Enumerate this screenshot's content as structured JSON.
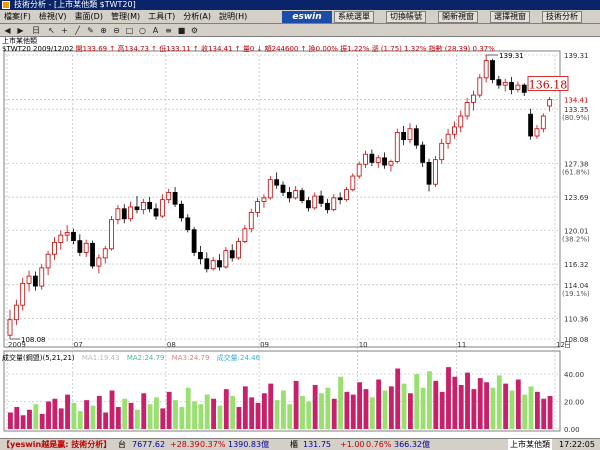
{
  "window": {
    "title": "技術分析 - [上市某他類 $TWT20]"
  },
  "menu": [
    {
      "label": "檔案(F)"
    },
    {
      "label": "檢視(V)"
    },
    {
      "label": "畫面(D)"
    },
    {
      "label": "管理(M)"
    },
    {
      "label": "工具(T)"
    },
    {
      "label": "分析(A)"
    },
    {
      "label": "說明(H)"
    }
  ],
  "brand": "eswin",
  "top_buttons": [
    {
      "label": "系統選單"
    },
    {
      "label": "切換帳號"
    },
    {
      "label": "開新視窗"
    },
    {
      "label": "選擇視窗"
    },
    {
      "label": "技術分析"
    }
  ],
  "toolbar": {
    "freq_label": "日",
    "items": [
      "arrow-icon",
      "crosshair-icon",
      "line-tool-icon",
      "pen-icon",
      "zoom-in-icon",
      "zoom-out-icon",
      "rect-icon",
      "ellipse-icon",
      "text-icon",
      "fib-icon",
      "color-icon",
      "gear-icon"
    ]
  },
  "header": {
    "name": "上市某他類",
    "info_prefix": "$TWT20 2009/12/02",
    "info": "開133.69 ↑ 高134.73 ↑ 低133.11 ↑ 收134.41 ↑ 量0 ↓ 額244600 ↑ 換0.00% 振1.22% 漲 (1.75) 1.32% 指數 (28.39) 0.37%"
  },
  "chart_data": [
    {
      "type": "candlestick",
      "y_ticks": [
        "139.31",
        "134.41",
        "133.35",
        "127.38",
        "123.69",
        "120.01",
        "116.32",
        "114.04",
        "110.36",
        "108.08"
      ],
      "y_ticks_pct": [
        "(80.9%)",
        "(61.8%)",
        "(38.2%)",
        "(19.1%)"
      ],
      "ylim": [
        108.08,
        139.31
      ],
      "x_ticks": [
        "2009",
        "07",
        "08",
        "09",
        "10",
        "11",
        "12"
      ],
      "annotations": {
        "high_label": "139.31",
        "low_label": "108.08",
        "current_price_box": "136.18",
        "current_price": "134.41"
      },
      "candles": [
        [
          108.5,
          111.3,
          108.1,
          110.2
        ],
        [
          110.2,
          112.4,
          109.6,
          111.8
        ],
        [
          111.8,
          114.8,
          111.2,
          114.2
        ],
        [
          114.2,
          115.6,
          113.3,
          115.0
        ],
        [
          115.0,
          115.5,
          113.4,
          113.9
        ],
        [
          113.9,
          116.3,
          113.5,
          115.9
        ],
        [
          115.9,
          117.8,
          115.1,
          117.4
        ],
        [
          117.4,
          119.3,
          116.8,
          118.7
        ],
        [
          118.7,
          120.0,
          117.9,
          119.5
        ],
        [
          119.5,
          120.6,
          118.8,
          119.8
        ],
        [
          119.8,
          120.2,
          118.5,
          118.9
        ],
        [
          118.9,
          119.6,
          117.2,
          117.6
        ],
        [
          117.6,
          119.0,
          117.1,
          118.6
        ],
        [
          118.6,
          118.9,
          115.8,
          116.1
        ],
        [
          116.1,
          117.4,
          115.3,
          117.0
        ],
        [
          117.0,
          118.3,
          116.4,
          118.0
        ],
        [
          118.0,
          121.6,
          117.8,
          121.2
        ],
        [
          121.2,
          122.8,
          120.7,
          122.4
        ],
        [
          122.4,
          122.9,
          120.8,
          121.3
        ],
        [
          121.3,
          123.2,
          121.0,
          122.6
        ],
        [
          122.6,
          123.8,
          121.9,
          122.3
        ],
        [
          122.3,
          123.5,
          121.8,
          123.1
        ],
        [
          123.1,
          123.7,
          122.0,
          122.4
        ],
        [
          122.4,
          123.0,
          121.2,
          121.6
        ],
        [
          121.6,
          124.0,
          121.4,
          123.4
        ],
        [
          123.4,
          124.6,
          123.0,
          124.2
        ],
        [
          124.2,
          124.8,
          122.6,
          122.9
        ],
        [
          122.9,
          123.3,
          121.0,
          121.4
        ],
        [
          121.4,
          121.8,
          119.8,
          120.1
        ],
        [
          120.1,
          120.4,
          117.2,
          117.6
        ],
        [
          117.6,
          118.3,
          116.3,
          116.9
        ],
        [
          116.9,
          117.6,
          115.4,
          115.8
        ],
        [
          115.8,
          117.1,
          115.6,
          116.7
        ],
        [
          116.7,
          117.4,
          115.6,
          116.0
        ],
        [
          116.0,
          118.2,
          115.8,
          117.8
        ],
        [
          117.8,
          118.5,
          116.6,
          117.0
        ],
        [
          117.0,
          119.2,
          116.8,
          118.8
        ],
        [
          118.8,
          120.6,
          118.6,
          120.2
        ],
        [
          120.2,
          122.4,
          119.8,
          122.0
        ],
        [
          122.0,
          123.6,
          121.5,
          123.2
        ],
        [
          123.2,
          124.0,
          122.5,
          123.6
        ],
        [
          123.6,
          126.0,
          123.4,
          125.6
        ],
        [
          125.6,
          126.4,
          124.6,
          125.0
        ],
        [
          125.0,
          125.4,
          123.8,
          124.2
        ],
        [
          124.2,
          124.8,
          123.1,
          123.6
        ],
        [
          123.6,
          124.9,
          123.4,
          124.4
        ],
        [
          124.4,
          124.7,
          123.0,
          123.3
        ],
        [
          123.3,
          123.7,
          122.1,
          122.5
        ],
        [
          122.5,
          124.2,
          122.3,
          123.8
        ],
        [
          123.8,
          124.4,
          122.6,
          123.0
        ],
        [
          123.0,
          123.5,
          121.9,
          122.3
        ],
        [
          122.3,
          124.0,
          122.1,
          123.6
        ],
        [
          123.6,
          124.2,
          122.9,
          123.4
        ],
        [
          123.4,
          124.8,
          123.2,
          124.5
        ],
        [
          124.5,
          126.3,
          124.3,
          126.0
        ],
        [
          126.0,
          127.6,
          125.7,
          127.3
        ],
        [
          127.3,
          128.8,
          126.9,
          128.4
        ],
        [
          128.4,
          128.9,
          127.1,
          127.5
        ],
        [
          127.5,
          128.3,
          126.9,
          128.0
        ],
        [
          128.0,
          128.6,
          126.8,
          127.2
        ],
        [
          127.2,
          127.8,
          126.5,
          127.6
        ],
        [
          127.6,
          131.2,
          127.4,
          130.8
        ],
        [
          130.8,
          131.5,
          129.4,
          130.0
        ],
        [
          130.0,
          131.8,
          129.6,
          131.2
        ],
        [
          131.2,
          131.6,
          129.0,
          129.4
        ],
        [
          129.4,
          129.8,
          127.0,
          127.5
        ],
        [
          127.5,
          127.9,
          124.3,
          125.1
        ],
        [
          125.1,
          128.2,
          124.8,
          127.8
        ],
        [
          127.8,
          130.1,
          127.4,
          129.6
        ],
        [
          129.6,
          131.2,
          129.0,
          130.6
        ],
        [
          130.6,
          132.0,
          130.1,
          131.4
        ],
        [
          131.4,
          133.2,
          130.8,
          132.6
        ],
        [
          132.6,
          134.6,
          132.2,
          134.1
        ],
        [
          134.1,
          135.4,
          133.2,
          134.9
        ],
        [
          134.9,
          137.2,
          134.6,
          136.8
        ],
        [
          136.8,
          139.3,
          136.3,
          138.7
        ],
        [
          138.7,
          138.9,
          136.2,
          136.6
        ],
        [
          136.6,
          137.0,
          135.6,
          136.0
        ],
        [
          136.0,
          136.7,
          135.3,
          136.3
        ],
        [
          136.3,
          136.9,
          135.0,
          135.5
        ],
        [
          135.5,
          136.4,
          135.2,
          136.0
        ],
        [
          136.0,
          136.2,
          134.8,
          135.2
        ],
        [
          132.8,
          133.4,
          130.0,
          130.4
        ],
        [
          130.4,
          131.6,
          130.1,
          131.2
        ],
        [
          131.2,
          132.9,
          130.8,
          132.6
        ],
        [
          133.7,
          134.7,
          133.1,
          134.4
        ]
      ]
    },
    {
      "type": "bar",
      "title": "成交量(鋼盟)(5,21,21)",
      "legend": [
        "MA1:19.43",
        "MA2:24.79",
        "MA3:24.79",
        "成交量:24.46"
      ],
      "y_ticks": [
        "40.00",
        "20.00",
        "0.00"
      ],
      "ylim": [
        0,
        48
      ],
      "values": [
        12,
        16,
        10,
        14,
        18,
        11,
        20,
        22,
        15,
        25,
        19,
        13,
        21,
        17,
        24,
        12,
        28,
        16,
        22,
        19,
        14,
        26,
        18,
        23,
        15,
        27,
        21,
        16,
        30,
        20,
        18,
        25,
        22,
        17,
        29,
        24,
        16,
        31,
        23,
        19,
        26,
        33,
        21,
        28,
        18,
        35,
        24,
        20,
        32,
        26,
        30,
        22,
        38,
        27,
        25,
        34,
        29,
        23,
        36,
        28,
        31,
        44,
        33,
        26,
        40,
        30,
        42,
        35,
        27,
        45,
        38,
        32,
        41,
        29,
        37,
        34,
        30,
        39,
        33,
        28,
        36,
        25,
        31,
        27,
        22,
        24
      ]
    }
  ],
  "status": {
    "brand": "【yeswin越是贏: 技術分析】",
    "tw_label": "台",
    "tw_index": "7677.62",
    "tw_change": "+28.39",
    "tw_pct": "0.37%",
    "tw_amount": "1390.83億",
    "otc_label": "櫃",
    "otc_index": "131.75",
    "otc_change": "+1.00",
    "otc_pct": "0.76%",
    "otc_amount": "366.32億",
    "symbol": "上市某他類",
    "time": "17:22:05"
  },
  "colors": {
    "up": "#c80000",
    "down": "#000000",
    "vol_up": "#c8206a",
    "vol_down": "#9ae070",
    "grid": "#b0b0b0"
  }
}
